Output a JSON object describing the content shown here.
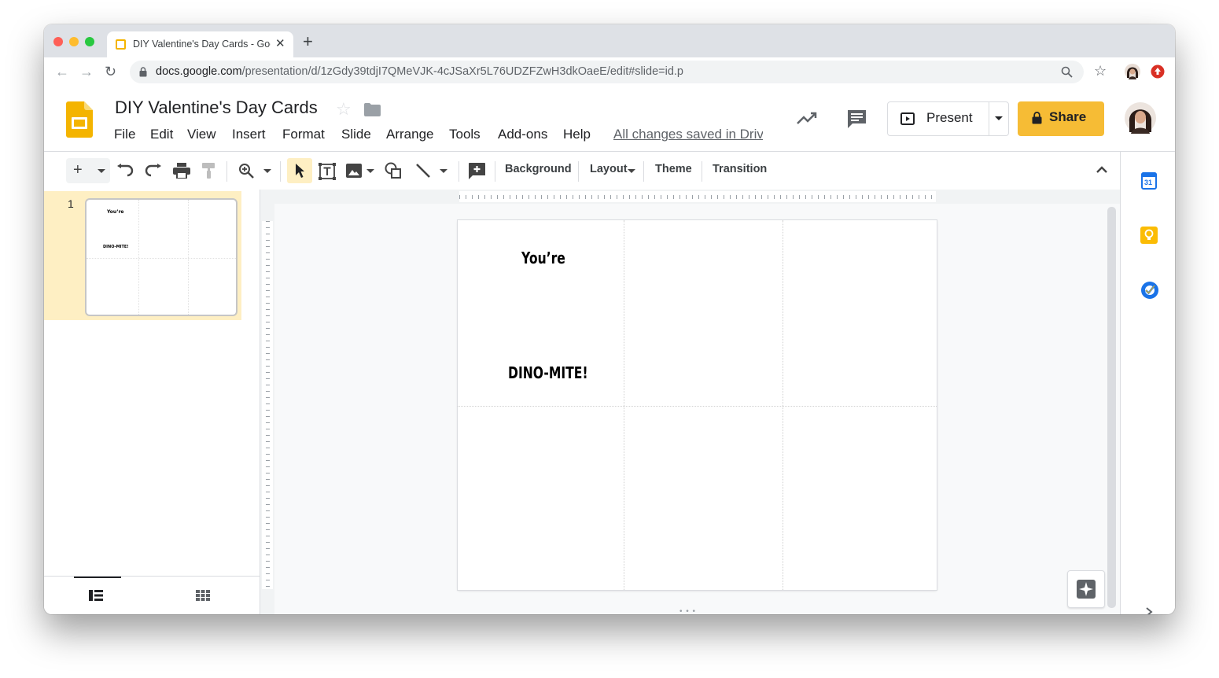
{
  "browser": {
    "tab_title": "DIY Valentine's Day Cards - Google Slides",
    "url_domain": "docs.google.com",
    "url_path": "/presentation/d/1zGdy39tdjI7QMeVJK-4cJSaXr5L76UDZFZwH3dkOaeE/edit#slide=id.p"
  },
  "doc": {
    "title": "DIY Valentine's Day Cards",
    "menus": [
      "File",
      "Edit",
      "View",
      "Insert",
      "Format",
      "Slide",
      "Arrange",
      "Tools",
      "Add-ons",
      "Help"
    ],
    "saved_status": "All changes saved in Drive"
  },
  "header_buttons": {
    "present": "Present",
    "share": "Share"
  },
  "toolbar": {
    "background": "Background",
    "layout": "Layout",
    "theme": "Theme",
    "transition": "Transition"
  },
  "filmstrip": {
    "slide_number": "1"
  },
  "slide": {
    "line1": "You’re",
    "line2": "DINO-MITE!"
  },
  "side_panel": {
    "calendar_date": "31"
  },
  "colors": {
    "accent_yellow": "#f6bc35",
    "slides_brand": "#f4b400",
    "selected_slide_bg": "#feefc3"
  }
}
